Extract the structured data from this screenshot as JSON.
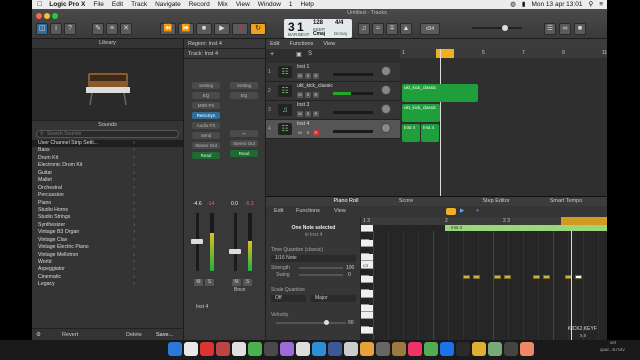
{
  "menubar": {
    "app": "Logic Pro X",
    "items": [
      "File",
      "Edit",
      "Track",
      "Navigate",
      "Record",
      "Mix",
      "View",
      "Window",
      "1",
      "Help"
    ],
    "clock": "Mon 13 apr  13:01"
  },
  "window": {
    "title": "Untitled - Tracks",
    "lcd": {
      "bar": "3",
      "beat": "1",
      "bar_label": "BAR",
      "beat_label": "BEAT",
      "tempo": "128",
      "tempo_label": "KEEP",
      "key": "Cmaj",
      "sig": "4/4",
      "sig_label": "Dcmaj"
    },
    "cpu_label": "d34"
  },
  "library": {
    "header": "Library",
    "sounds_label": "Sounds",
    "search_placeholder": "Search Sounds",
    "items": [
      "User Channel Strip Setti...",
      "Bass",
      "Drum Kit",
      "Electronic Drum Kit",
      "Guitar",
      "Mallet",
      "Orchestral",
      "Percussion",
      "Piano",
      "Studio Horns",
      "Studio Strings",
      "Synthesizer",
      "Vintage B3 Organ",
      "Vintage Clav",
      "Vintage Electric Piano",
      "Vintage Mellotron",
      "World",
      "Arpeggiator",
      "Cinematic",
      "Legacy"
    ],
    "footer": {
      "revert": "Revert",
      "delete": "Delete",
      "save": "Save..."
    }
  },
  "inspector": {
    "region": "Region: Inst 4",
    "track": "Track: Inst 4",
    "strip1": {
      "setting": "Setting",
      "eq": "EQ",
      "input": "MIDI FX",
      "plugin": "RetroSyn",
      "audio_fx": "Audio FX",
      "send": "Send",
      "out": "Stereo Out",
      "mode": "Read",
      "pan_l": "-4.6",
      "pan_r": "-14",
      "name": "Inst 4",
      "ms_m": "M",
      "ms_s": "S"
    },
    "strip2": {
      "setting": "Setting",
      "eq": "EQ",
      "out": "Stereo Out",
      "mode": "Read",
      "pan_l": "0.0",
      "pan_r": "-5.3",
      "name": "Bnce",
      "ms_m": "M",
      "ms_s": "S"
    }
  },
  "tracks": {
    "menu": [
      "Edit",
      "Functions",
      "View"
    ],
    "list": [
      {
        "num": "1",
        "name": "Inst 1",
        "icon": "piano-icon",
        "color": "#22a23a"
      },
      {
        "num": "2",
        "name": "ukt_kick_classic",
        "icon": "drum-icon",
        "color": "#22a23a"
      },
      {
        "num": "3",
        "name": "Inst 3",
        "icon": "note-icon",
        "color": "#22a23a"
      },
      {
        "num": "4",
        "name": "Inst 4",
        "icon": "synth-icon",
        "color": "#d63030"
      }
    ],
    "ruler": [
      "1",
      "3",
      "5",
      "7",
      "9",
      "11"
    ],
    "regions": [
      {
        "label": "ukt_kick_classic",
        "track": 2
      },
      {
        "label": "ukt_kick_classic",
        "track": 3
      },
      {
        "label": "Inst 4",
        "track": 4
      },
      {
        "label": "Inst 4",
        "track": 4
      }
    ]
  },
  "piano_roll": {
    "tabs": [
      "Piano Roll",
      "Score",
      "Step Editor",
      "Smart Tempo"
    ],
    "menu": [
      "Edit",
      "Functions",
      "View"
    ],
    "selection": "One Note selected",
    "selection_sub": "in Inst 4",
    "quantize_label": "Time Quantize (classic)",
    "quantize_value": "1/16 Note",
    "strength_label": "Strength",
    "strength_value": "100",
    "swing_label": "Swing",
    "swing_value": "0",
    "scale_label": "Scale Quantize",
    "scale_off": "Off",
    "scale_mode": "Major",
    "velocity_label": "Velocity",
    "velocity_value": "90",
    "ruler": [
      "1 3",
      "2",
      "2 3",
      "3"
    ],
    "region_label": "Inst 4",
    "c_label": "C3"
  },
  "desktop": {
    "file1": "KICK2.KEYF",
    "file2": "5,8",
    "file3": "set",
    "file4": "quar...8.m4v"
  },
  "colors": {
    "accent": "#f5a623",
    "region_green": "#1f9e3c",
    "note": "#c8b54a"
  }
}
